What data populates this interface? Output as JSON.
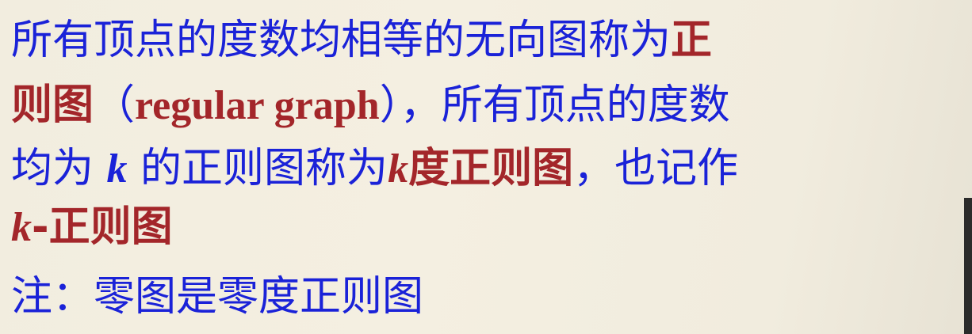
{
  "lines": {
    "l1": {
      "text": "所有顶点的度数均相等的无向图称为",
      "term": "正"
    },
    "l2": {
      "term": "则图",
      "paren_open": "（",
      "en": "regular graph",
      "paren_close": "）",
      "comma": "，",
      "text": "所有顶点的度数"
    },
    "l3": {
      "a": "均为 ",
      "k": "k",
      "b": " 的正则图称为",
      "k2": "k",
      "term": "度正则图",
      "c": "，也记作"
    },
    "l4": {
      "k": "k",
      "term": "-正则图"
    },
    "l5": {
      "text": "注：零图是零度正则图"
    }
  },
  "colors": {
    "text_blue": "#1a22d8",
    "term_red": "#a3262a",
    "background": "#f2eddf"
  }
}
